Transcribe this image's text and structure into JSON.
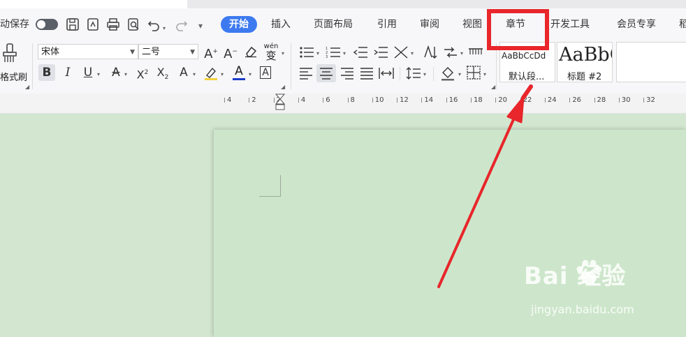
{
  "topbar": {
    "doc_title": ""
  },
  "quick_access": {
    "autosave_label": "动保存",
    "more": "▾"
  },
  "tabs": [
    {
      "label": "开始",
      "active": true
    },
    {
      "label": "插入"
    },
    {
      "label": "页面布局"
    },
    {
      "label": "引用"
    },
    {
      "label": "审阅"
    },
    {
      "label": "视图"
    },
    {
      "label": "章节",
      "highlighted": true
    },
    {
      "label": "开发工具"
    },
    {
      "label": "会员专享"
    },
    {
      "label": "稻"
    }
  ],
  "ribbon": {
    "format_painter_label": "格式刷",
    "font_name": "宋体",
    "font_size": "二号",
    "pinyin_label": "wén",
    "pinyin_char": "变",
    "styles": [
      {
        "preview": "AaBbCcDd",
        "label": "默认段..."
      },
      {
        "preview": "AaBbC(",
        "label": "标题 #2"
      }
    ]
  },
  "ruler": {
    "ticks": [
      "4",
      "2",
      "2",
      "4",
      "6",
      "8",
      "10",
      "12",
      "14",
      "16",
      "18",
      "20",
      "22",
      "24",
      "26",
      "28",
      "30",
      "32"
    ]
  },
  "watermark": {
    "logo": "Bai  经验",
    "url": "jingyan.baidu.com"
  },
  "colors": {
    "accent": "#3d7af0",
    "annotation": "#e8262b",
    "page_bg": "#cde6cb",
    "workspace_bg": "#d3e7d0",
    "font_color_bar": "#1a3cc8",
    "highlight_bar": "#f2d23a"
  }
}
